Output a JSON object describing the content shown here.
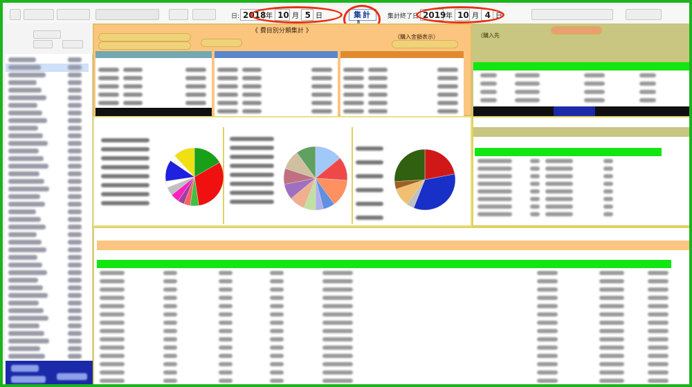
{
  "header": {
    "start_label": "日:",
    "start_year": "2018",
    "start_month": "10",
    "start_day": "5",
    "unit_year": "年",
    "unit_month": "月",
    "unit_day": "日",
    "calc_button": "集計",
    "end_label": "集計終了日:",
    "end_year": "2019",
    "end_month": "10",
    "end_day": "4"
  },
  "center_panel": {
    "title": "《 費目別分類集計 》",
    "purchase_display": "（購入金額表示）"
  },
  "right_panel": {
    "title": "（購入先"
  },
  "colors": {
    "frame": "#1db31d",
    "highlight_oval": "#e83010",
    "header_orange": "#fbc580",
    "row_green": "#12e612",
    "sidebar_footer": "#1a2aa8"
  },
  "pie_charts": [
    {
      "slices": [
        {
          "value": 14,
          "color": "#18a018"
        },
        {
          "value": 26,
          "color": "#f01010"
        },
        {
          "value": 4,
          "color": "#40c040"
        },
        {
          "value": 3,
          "color": "#ff6060"
        },
        {
          "value": 3,
          "color": "#a040a0"
        },
        {
          "value": 4,
          "color": "#ff20c0"
        },
        {
          "value": 4,
          "color": "#c0c0c0"
        },
        {
          "value": 3,
          "color": "#ffffff"
        },
        {
          "value": 10,
          "color": "#2020e0"
        },
        {
          "value": 3,
          "color": "#fffff0"
        },
        {
          "value": 10,
          "color": "#f0e010"
        }
      ]
    },
    {
      "slices": [
        {
          "value": 14,
          "color": "#a0c8f8"
        },
        {
          "value": 12,
          "color": "#f04848"
        },
        {
          "value": 14,
          "color": "#ff9060"
        },
        {
          "value": 6,
          "color": "#6090e0"
        },
        {
          "value": 4,
          "color": "#b0b0f0"
        },
        {
          "value": 6,
          "color": "#c0e0a0"
        },
        {
          "value": 8,
          "color": "#f0b090"
        },
        {
          "value": 8,
          "color": "#a070c0"
        },
        {
          "value": 8,
          "color": "#c07080"
        },
        {
          "value": 10,
          "color": "#d0c0a0"
        },
        {
          "value": 10,
          "color": "#60a060"
        }
      ]
    },
    {
      "slices": [
        {
          "value": 22,
          "color": "#d01818"
        },
        {
          "value": 34,
          "color": "#1830c8"
        },
        {
          "value": 4,
          "color": "#c0c0c0"
        },
        {
          "value": 10,
          "color": "#f0c070"
        },
        {
          "value": 4,
          "color": "#a06020"
        },
        {
          "value": 26,
          "color": "#306010"
        }
      ]
    }
  ]
}
